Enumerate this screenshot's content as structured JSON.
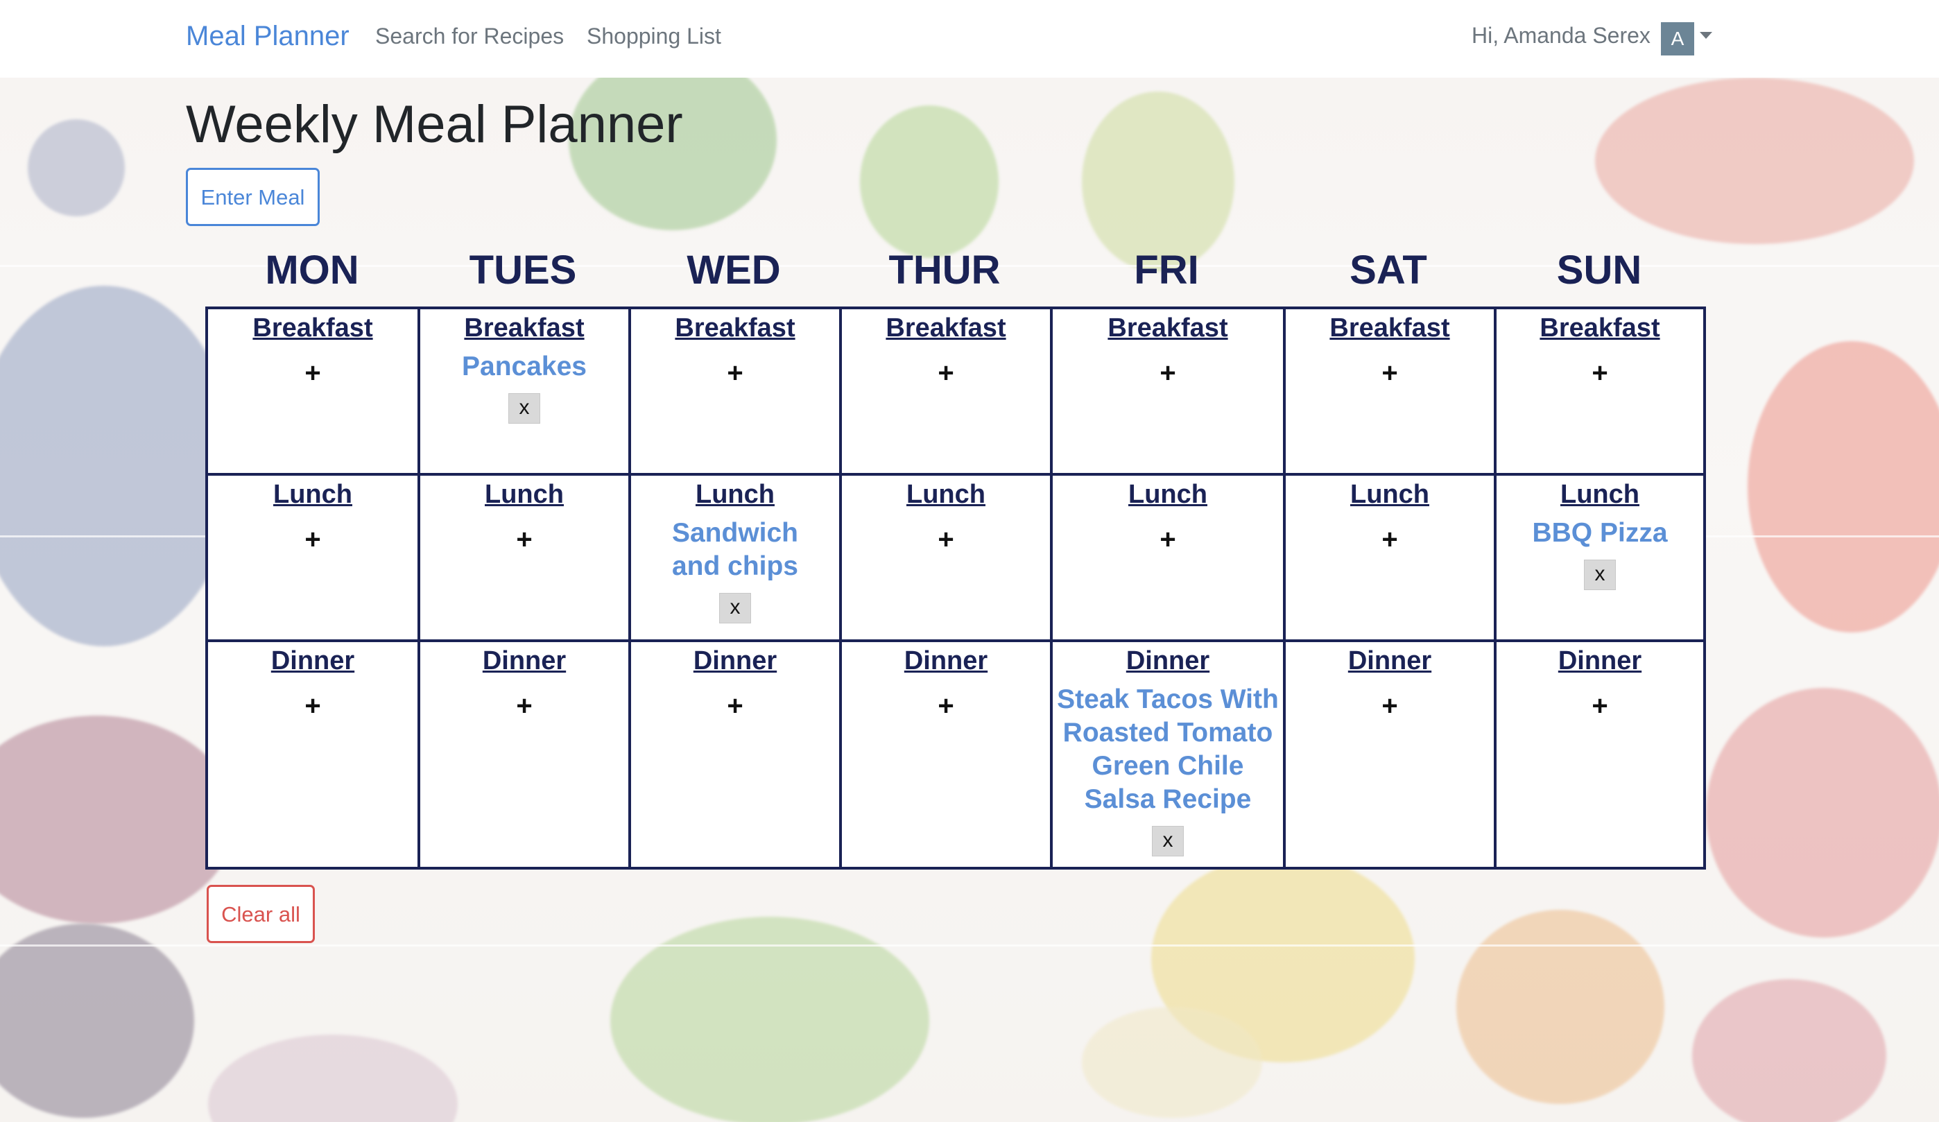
{
  "nav": {
    "brand": "Meal Planner",
    "links": [
      "Search for Recipes",
      "Shopping List"
    ],
    "greeting": "Hi, Amanda Serex",
    "avatar_initial": "A"
  },
  "page": {
    "title": "Weekly Meal Planner",
    "enter_meal": "Enter Meal",
    "clear_all": "Clear all"
  },
  "days": [
    "MON",
    "TUES",
    "WED",
    "THUR",
    "FRI",
    "SAT",
    "SUN"
  ],
  "meals": [
    "Breakfast",
    "Lunch",
    "Dinner"
  ],
  "add_glyph": "+",
  "remove_glyph": "x",
  "planned": {
    "tues_breakfast": "Pancakes",
    "wed_lunch": "Sandwich and chips",
    "sun_lunch": "BBQ Pizza",
    "fri_dinner": "Steak Tacos With Roasted Tomato Green Chile Salsa Recipe"
  },
  "colors": {
    "brand": "#4a86d8",
    "grid": "#1a2255",
    "dish": "#5b8fd6",
    "danger": "#d9534f"
  }
}
